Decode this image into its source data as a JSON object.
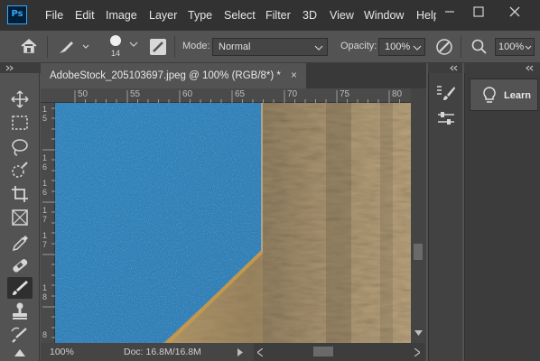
{
  "app": {
    "logo_text": "Ps",
    "menus": [
      "File",
      "Edit",
      "Image",
      "Layer",
      "Type",
      "Select",
      "Filter",
      "3D",
      "View",
      "Window",
      "Help"
    ]
  },
  "options_bar": {
    "brush_size": "14",
    "mode_label": "Mode:",
    "mode_value": "Normal",
    "opacity_label": "Opacity:",
    "opacity_value": "100%",
    "zoom_value": "100%"
  },
  "document": {
    "tab_title": "AdobeStock_205103697.jpeg @ 100% (RGB/8*) *",
    "close_glyph": "×",
    "ruler_top": [
      "50",
      "55",
      "60",
      "65",
      "70",
      "75",
      "80"
    ],
    "ruler_left": [
      [
        "1",
        "5"
      ],
      [
        "1",
        "6"
      ],
      [
        "1",
        "6"
      ],
      [
        "1",
        "7"
      ],
      [
        "1",
        "7"
      ],
      [
        "1",
        "8"
      ]
    ],
    "ruler_left_last": "8"
  },
  "status": {
    "zoom": "100%",
    "doc_size": "Doc: 16.8M/16.8M"
  },
  "panels": {
    "learn_label": "Learn"
  },
  "colors": {
    "accent": "#31a8ff",
    "menu_bg": "#323232",
    "ui_bg": "#535353",
    "sky_blue": "#3a8ec5",
    "wall_tan": "#b8a07a"
  }
}
